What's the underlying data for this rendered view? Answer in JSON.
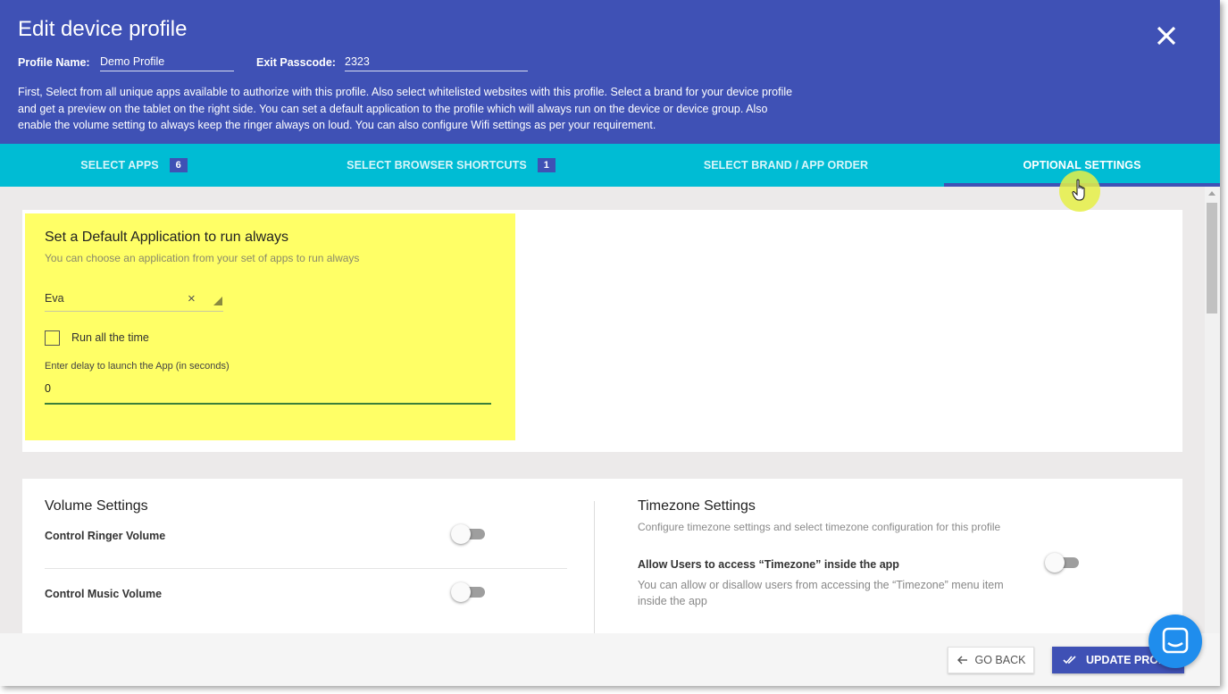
{
  "header": {
    "title": "Edit device profile",
    "profile_name_label": "Profile Name:",
    "profile_name_value": "Demo Profile",
    "exit_passcode_label": "Exit Passcode:",
    "exit_passcode_value": "2323",
    "intro": "First, Select from all unique apps available to authorize with this profile. Also select whitelisted websites with this profile. Select a brand for your device profile and get a preview on the tablet on the right side. You can set a default application to the profile which will always run on the device or device group. Also enable the volume setting to always keep the ringer always on loud. You can also configure Wifi settings as per your requirement."
  },
  "tabs": [
    {
      "label": "SELECT APPS",
      "badge": "6"
    },
    {
      "label": "SELECT BROWSER SHORTCUTS",
      "badge": "1"
    },
    {
      "label": "SELECT BRAND / APP ORDER"
    },
    {
      "label": "OPTIONAL SETTINGS",
      "active": true
    }
  ],
  "default_app": {
    "title": "Set a Default Application to run always",
    "subtitle": "You can choose an application from your set of apps to run always",
    "selected_app": "Eva",
    "clear_symbol": "×",
    "run_all_time_label": "Run all the time",
    "run_all_time_checked": false,
    "delay_label": "Enter delay to launch the App (in seconds)",
    "delay_value": "0"
  },
  "volume": {
    "title": "Volume Settings",
    "ringer_label": "Control Ringer Volume",
    "ringer_on": false,
    "music_label": "Control Music Volume",
    "music_on": false
  },
  "timezone": {
    "title": "Timezone Settings",
    "subtitle": "Configure timezone settings and select timezone configuration for this profile",
    "access_label": "Allow Users to access “Timezone” inside the app",
    "access_desc": "You can allow or disallow users from accessing the “Timezone” menu item inside the app",
    "access_on": false
  },
  "footer": {
    "back_label": "GO BACK",
    "update_label": "UPDATE PROFILE"
  },
  "colors": {
    "primary": "#3f51b5",
    "tab_bar": "#00bcd4",
    "highlight": "#ffff66",
    "chat": "#1f8ded"
  },
  "icons": [
    "close-icon",
    "dropdown-arrow-icon",
    "arrow-left-icon",
    "double-check-icon",
    "chat-icon",
    "hand-pointer-icon"
  ]
}
